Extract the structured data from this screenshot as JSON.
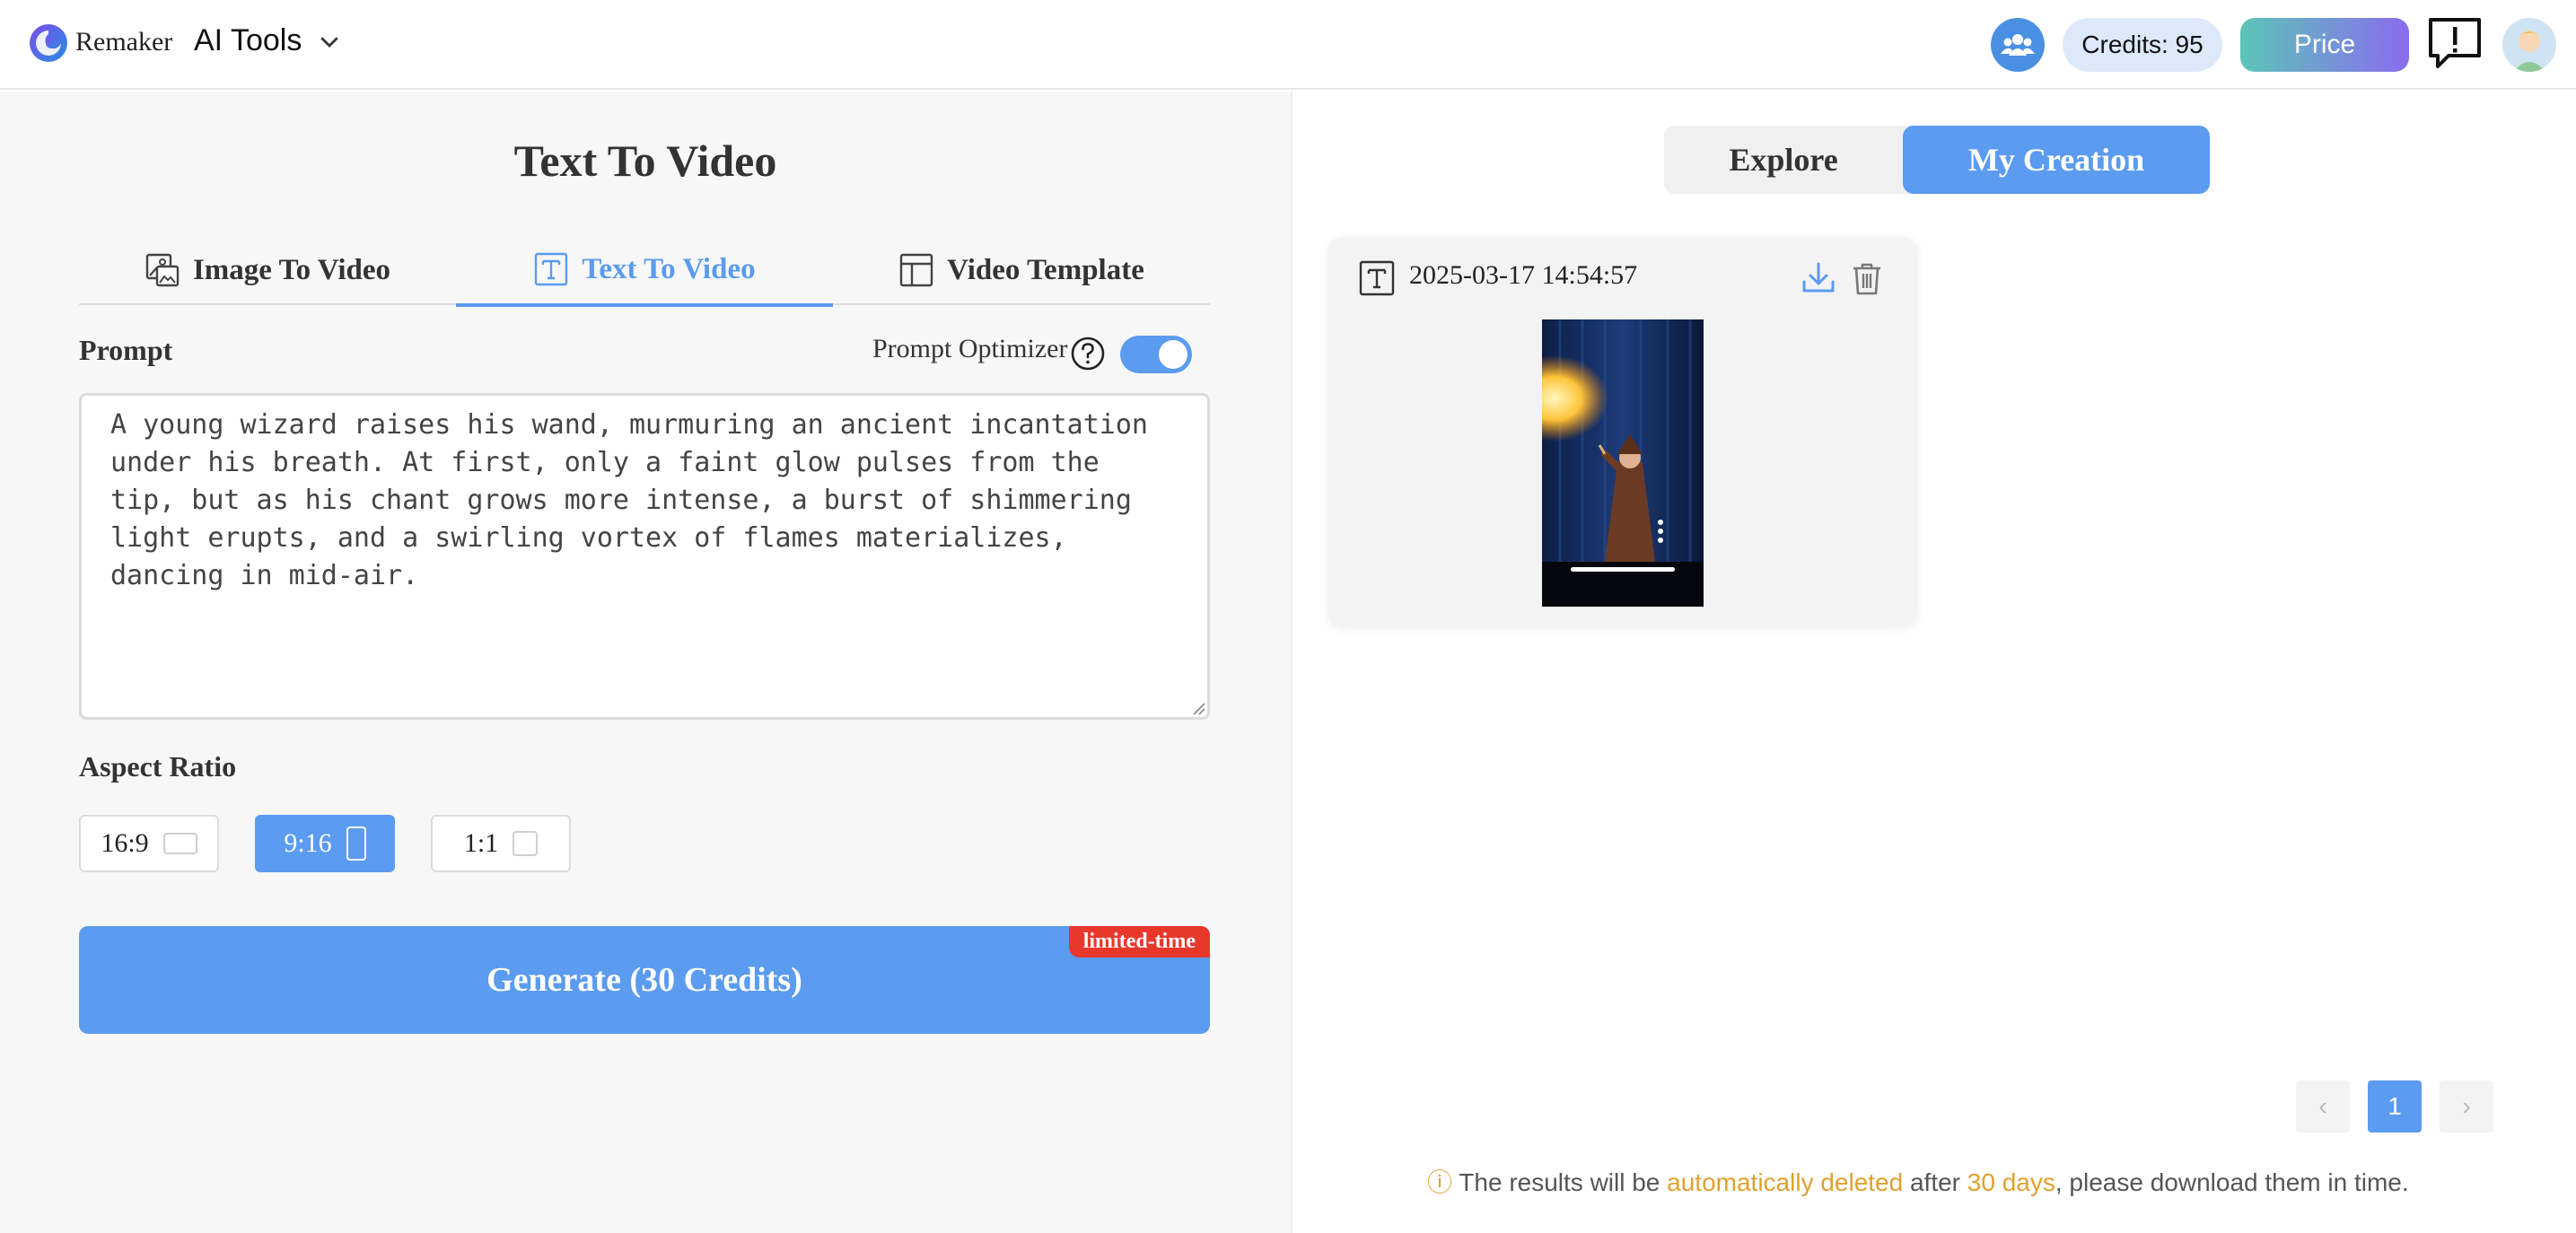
{
  "header": {
    "brand": "Remaker",
    "tools_label": "AI Tools",
    "credits_label": "Credits: 95",
    "price_label": "Price"
  },
  "main": {
    "title": "Text To Video",
    "tabs": [
      {
        "label": "Image To Video",
        "icon": "image-video-icon",
        "active": false
      },
      {
        "label": "Text To Video",
        "icon": "text-icon",
        "active": true
      },
      {
        "label": "Video Template",
        "icon": "template-icon",
        "active": false
      }
    ],
    "prompt_label": "Prompt",
    "optimizer_label": "Prompt Optimizer",
    "optimizer_on": true,
    "prompt_value": "A young wizard raises his wand, murmuring an ancient incantation under his breath. At first, only a faint glow pulses from the tip, but as his chant grows more intense, a burst of shimmering light erupts, and a swirling vortex of flames materializes, dancing in mid-air.",
    "aspect_label": "Aspect Ratio",
    "aspect_options": [
      {
        "label": "16:9",
        "active": false
      },
      {
        "label": "9:16",
        "active": true
      },
      {
        "label": "1:1",
        "active": false
      }
    ],
    "generate_label": "Generate (30 Credits)",
    "badge": "limited-time"
  },
  "right": {
    "tabs": [
      {
        "label": "Explore",
        "active": false
      },
      {
        "label": "My Creation",
        "active": true
      }
    ],
    "card": {
      "date": "2025-03-17 14:54:57",
      "type_icon": "text-icon"
    },
    "pagination": {
      "prev": "‹",
      "current": "1",
      "next": "›"
    },
    "notice": {
      "icon": "ⓘ",
      "part1": " The results will be ",
      "hl1": "automatically deleted",
      "part2": " after ",
      "hl2": "30 days",
      "part3": ", please download them in time."
    }
  },
  "colors": {
    "accent": "#5b9bf0",
    "badge": "#e8382c",
    "warning": "#e0a030",
    "panel_bg": "#f7f7f7"
  }
}
